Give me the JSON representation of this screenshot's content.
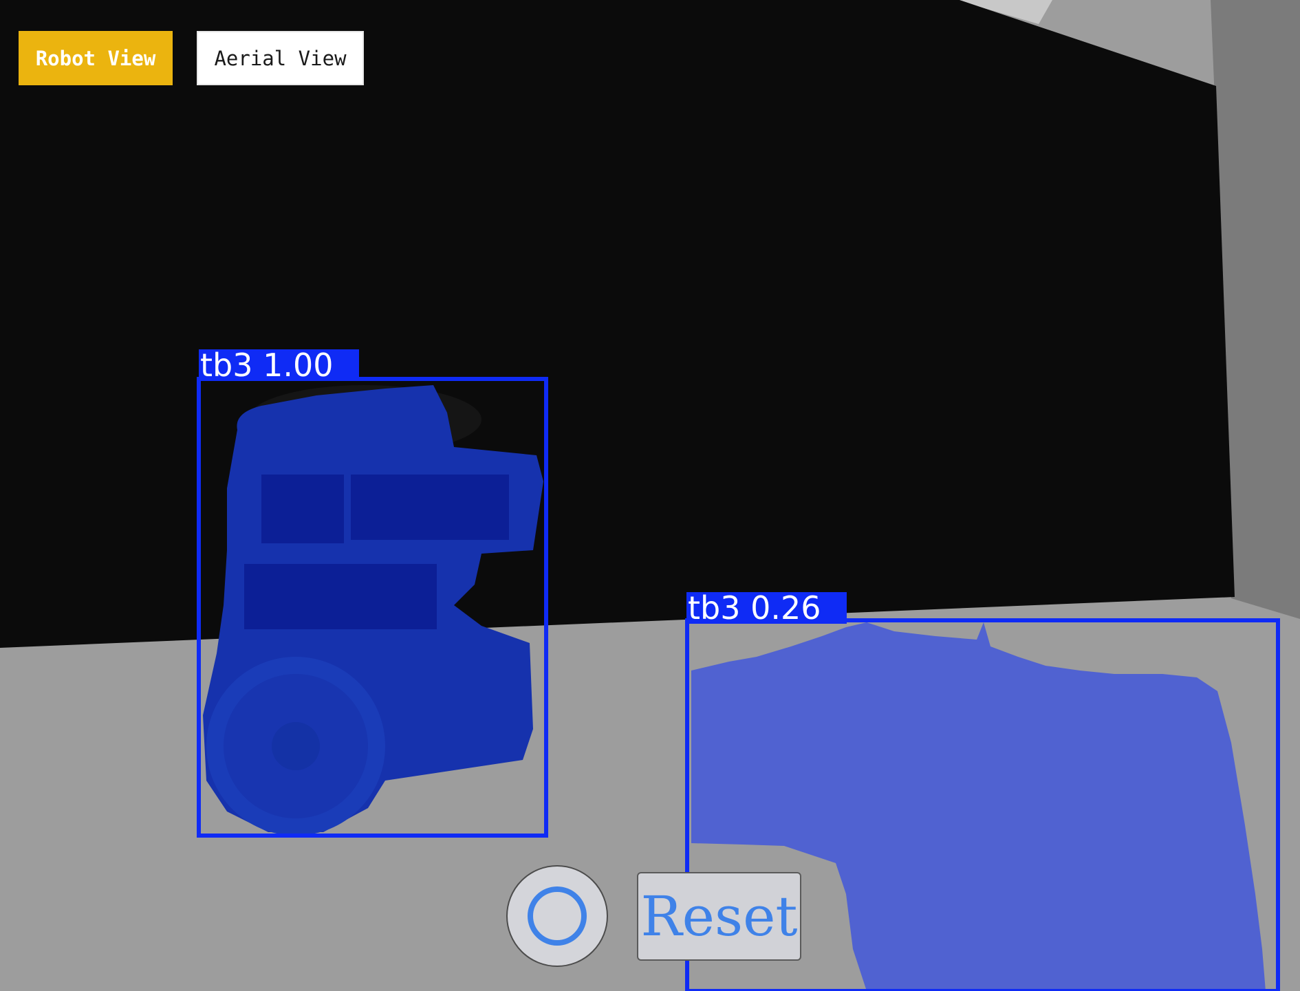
{
  "toolbar": {
    "robot_view_label": "Robot View",
    "aerial_view_label": "Aerial View",
    "robot_view_color": "#EBB40F",
    "robot_view_text_color": "#FFFFFF",
    "aerial_view_color": "#FFFFFF",
    "aerial_view_text_color": "#1A1A1A",
    "active_view": "Robot View"
  },
  "detections": [
    {
      "class": "tb3",
      "confidence": "1.00",
      "text": "tb3  1.00"
    },
    {
      "class": "tb3",
      "confidence": "0.26",
      "text": "tb3  0.26"
    }
  ],
  "detection_color": "#0F2BF5",
  "controls": {
    "record_icon": "circle-record-icon",
    "reset_label": "Reset",
    "control_accent": "#3F82E8"
  }
}
